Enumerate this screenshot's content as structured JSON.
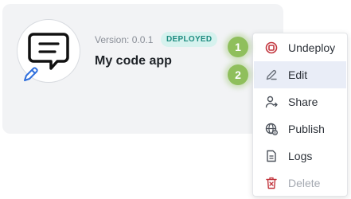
{
  "app": {
    "version": "Version: 0.0.1",
    "status": "DEPLOYED",
    "name": "My code app"
  },
  "menu": {
    "items": [
      {
        "label": "Undeploy",
        "icon": "undeploy-icon"
      },
      {
        "label": "Edit",
        "icon": "edit-icon"
      },
      {
        "label": "Share",
        "icon": "share-icon"
      },
      {
        "label": "Publish",
        "icon": "publish-icon"
      },
      {
        "label": "Logs",
        "icon": "logs-icon"
      },
      {
        "label": "Delete",
        "icon": "delete-icon"
      }
    ]
  },
  "markers": [
    "1",
    "2"
  ],
  "colors": {
    "badge_bg": "#d6f2ee",
    "badge_text": "#1e8c80",
    "undeploy_icon": "#c2353d",
    "delete_icon": "#c2353d",
    "pencil": "#2f6fdc",
    "marker": "#8fbf5c",
    "hover_bg": "#e9edf7"
  }
}
